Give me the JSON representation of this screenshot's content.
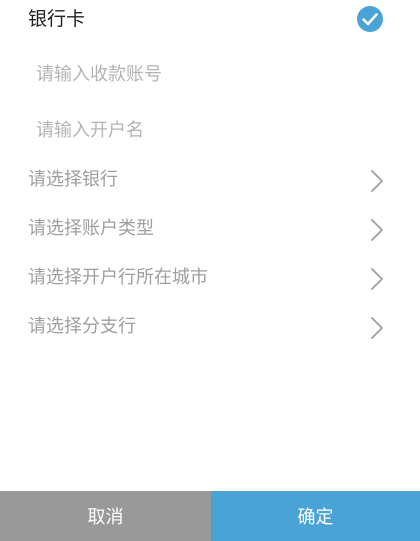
{
  "header": {
    "title": "银行卡"
  },
  "form": {
    "account_number_placeholder": "请输入收款账号",
    "account_name_placeholder": "请输入开户名",
    "select_bank_label": "请选择银行",
    "select_account_type_label": "请选择账户类型",
    "select_city_label": "请选择开户行所在城市",
    "select_branch_label": "请选择分支行"
  },
  "footer": {
    "cancel_label": "取消",
    "confirm_label": "确定"
  },
  "colors": {
    "accent": "#4aa3d7",
    "cancel_bg": "#999999"
  }
}
